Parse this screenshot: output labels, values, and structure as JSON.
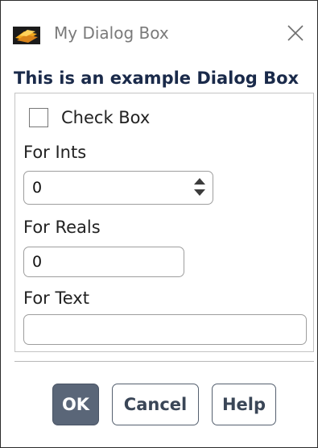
{
  "window": {
    "title": "My Dialog Box",
    "app_icon": "ansys-fluent-logo-icon",
    "close_icon": "close-icon"
  },
  "dialog": {
    "heading": "This is an example Dialog Box",
    "checkbox": {
      "label": "Check Box",
      "checked": false
    },
    "ints": {
      "label": "For Ints",
      "value": "0"
    },
    "reals": {
      "label": "For Reals",
      "value": "0"
    },
    "text": {
      "label": "For Text",
      "value": ""
    }
  },
  "buttons": {
    "ok": "OK",
    "cancel": "Cancel",
    "help": "Help"
  },
  "colors": {
    "primary_button": "#5a6678",
    "heading_text": "#1a2a4a"
  }
}
